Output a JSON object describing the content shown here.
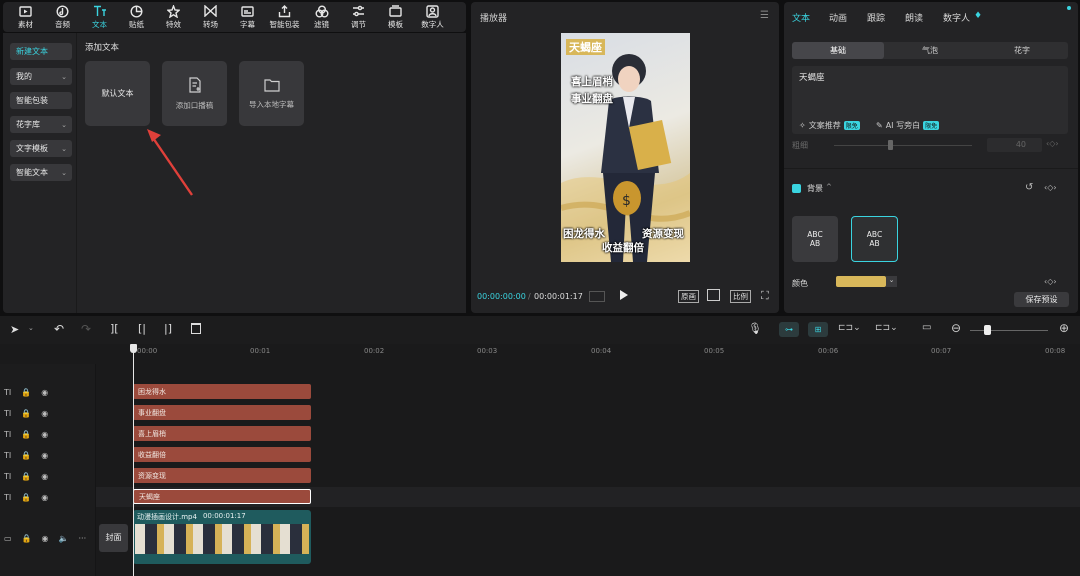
{
  "toolbar": {
    "items": [
      {
        "label": "素材",
        "icon": "media-icon"
      },
      {
        "label": "音频",
        "icon": "audio-icon"
      },
      {
        "label": "文本",
        "icon": "text-icon",
        "active": true
      },
      {
        "label": "贴纸",
        "icon": "sticker-icon"
      },
      {
        "label": "特效",
        "icon": "effects-icon"
      },
      {
        "label": "转场",
        "icon": "transition-icon"
      },
      {
        "label": "字幕",
        "icon": "subtitle-icon"
      },
      {
        "label": "智能包装",
        "icon": "smart-pack-icon"
      },
      {
        "label": "滤镜",
        "icon": "filter-icon"
      },
      {
        "label": "调节",
        "icon": "adjust-icon"
      },
      {
        "label": "模板",
        "icon": "template-icon"
      },
      {
        "label": "数字人",
        "icon": "digital-human-icon"
      }
    ]
  },
  "sidebar": {
    "items": [
      "新建文本",
      "我的",
      "智能包装",
      "花字库",
      "文字模板",
      "智能文本"
    ]
  },
  "library": {
    "section_title": "添加文本",
    "cards": [
      "默认文本",
      "添加口播稿",
      "导入本地字幕"
    ]
  },
  "player": {
    "title": "播放器",
    "current_time": "00:00:00:00",
    "total_time": "00:00:01:17",
    "btn_original": "原画",
    "btn_ratio": "比例",
    "overlay": {
      "badge": "天蝎座",
      "line1": "喜上眉梢",
      "line2": "事业翻盘",
      "line3": "困龙得水",
      "line4": "资源变现",
      "line5": "收益翻倍"
    }
  },
  "right": {
    "tabs": [
      "文本",
      "动画",
      "跟踪",
      "朗读",
      "数字人"
    ],
    "seg": [
      "基础",
      "气泡",
      "花字"
    ],
    "text_value": "天蝎座",
    "recommend": "文案推荐",
    "ai_write": "AI 写旁白",
    "free_badge": "限免",
    "weight_label": "粗细",
    "weight_value": "40",
    "bg_label": "背景",
    "style_label": "ABC AB",
    "color_label": "颜色",
    "save_preset": "保存预设",
    "bg_color": "#d8b75a"
  },
  "timeline": {
    "ticks": [
      "00:00",
      "00:01",
      "00:02",
      "00:03",
      "00:04",
      "00:05",
      "00:06",
      "00:07",
      "00:08"
    ],
    "text_clips": [
      "困龙得水",
      "事业翻盘",
      "喜上眉梢",
      "收益翻倍",
      "资源变现",
      "天蝎座"
    ],
    "video_clip": {
      "name": "动漫插画设计.mp4",
      "duration": "00:00:01:17"
    },
    "cover_label": "封面",
    "track_label": "TI"
  }
}
